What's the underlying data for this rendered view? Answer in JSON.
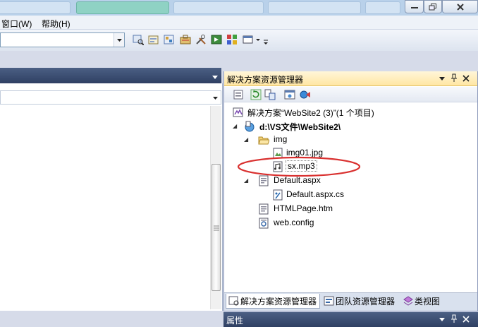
{
  "menubar": {
    "window_label": "窗口(W)",
    "help_label": "帮助(H)"
  },
  "solution_explorer": {
    "title": "解决方案资源管理器",
    "tree": {
      "solution": "解决方案“WebSite2 (3)”(1 个项目)",
      "project": "d:\\VS文件\\WebSite2\\",
      "folder_img": "img",
      "file_img01": "img01.jpg",
      "file_sx": "sx.mp3",
      "file_default_aspx": "Default.aspx",
      "file_default_cs": "Default.aspx.cs",
      "file_htmlpage": "HTMLPage.htm",
      "file_webconfig": "web.config"
    }
  },
  "bottom_tabs": {
    "solution_explorer": "解决方案资源管理器",
    "team_explorer": "团队资源管理器",
    "class_view": "类视图"
  },
  "properties": {
    "title": "属性"
  },
  "colors": {
    "highlight_ellipse": "#d9302f",
    "panel_header": "#ffe6a3",
    "dock_header": "#2f4063"
  }
}
